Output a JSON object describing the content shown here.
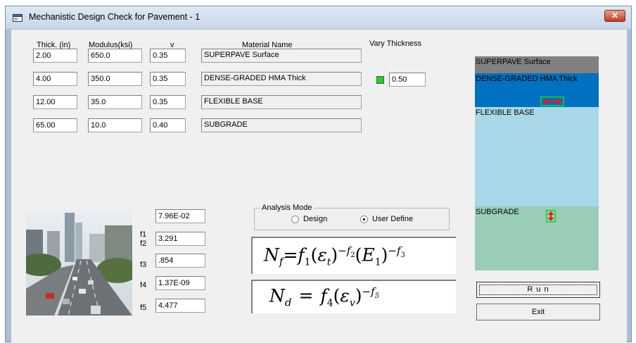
{
  "window": {
    "title": "Mechanistic Design Check for Pavement - 1",
    "close_glyph": "✕"
  },
  "headers": {
    "thick": "Thick. (in)",
    "modulus": "Modulus(ksi)",
    "nu": "v",
    "material": "Material Name",
    "vary": "Vary Thickness"
  },
  "layers": [
    {
      "thick": "2.00",
      "modulus": "650.0",
      "nu": "0.35",
      "name": "SUPERPAVE Surface"
    },
    {
      "thick": "4.00",
      "modulus": "350.0",
      "nu": "0.35",
      "name": "DENSE-GRADED HMA Thick"
    },
    {
      "thick": "12.00",
      "modulus": "35.0",
      "nu": "0.35",
      "name": "FLEXIBLE BASE"
    },
    {
      "thick": "65.00",
      "modulus": "10.0",
      "nu": "0.40",
      "name": "SUBGRADE"
    }
  ],
  "vary_thickness": {
    "value": "0.50",
    "indicator_color": "#22d022"
  },
  "factors": [
    {
      "label": "f1",
      "value": "7.96E-02"
    },
    {
      "label": "f2",
      "value": "3.291"
    },
    {
      "label": "f3",
      "value": ".854"
    },
    {
      "label": "f4",
      "value": "1.37E-09"
    },
    {
      "label": "f5",
      "value": "4.477"
    }
  ],
  "analysis_mode": {
    "title": "Analysis Mode",
    "options": [
      "Design",
      "User Define"
    ],
    "selected": "User Define"
  },
  "formulas": {
    "fatigue": {
      "N": "N",
      "sub": "f",
      "eq": "=",
      "f1": "f",
      "f1sub": "1",
      "eps": "ε",
      "epssub": "t",
      "exp1": "−f",
      "exp1sub": "2",
      "E": "E",
      "Esub": "1",
      "exp2": "−f",
      "exp2sub": "3"
    },
    "rutting": {
      "N": "N",
      "sub": "d",
      "eq": "=",
      "f": "f",
      "fsub": "4",
      "eps": "ε",
      "epssub": "v",
      "exp": "−f",
      "expsub": "5"
    }
  },
  "profile": {
    "layers": [
      {
        "label": "SUPERPAVE Surface",
        "color": "#808080"
      },
      {
        "label": "DENSE-GRADED HMA Thick",
        "color": "#0070c0"
      },
      {
        "label": "FLEXIBLE BASE",
        "color": "#a8d8e8"
      },
      {
        "label": "SUBGRADE",
        "color": "#99cdb7"
      }
    ],
    "marker_color": "#e8192c",
    "marker_border": "#22d022"
  },
  "buttons": {
    "run": "R u n",
    "exit": "Exit"
  }
}
